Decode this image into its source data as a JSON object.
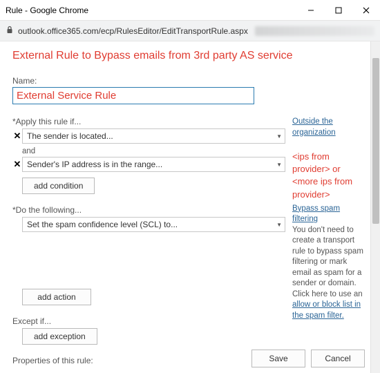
{
  "window": {
    "title": "Rule - Google Chrome"
  },
  "address": {
    "url_visible": "outlook.office365.com/ecp/RulesEditor/EditTransportRule.aspx"
  },
  "page": {
    "title": "External Rule to Bypass emails from 3rd party AS service",
    "name_label": "Name:",
    "name_value": "External Service Rule"
  },
  "apply": {
    "section_label": "*Apply this rule if...",
    "and_label": "and",
    "conditions": [
      {
        "text": "The sender is located..."
      },
      {
        "text": "Sender's IP address is in the range..."
      }
    ],
    "add_condition": "add condition"
  },
  "do": {
    "section_label": "*Do the following...",
    "actions": [
      {
        "text": "Set the spam confidence level (SCL) to..."
      }
    ],
    "add_action": "add action"
  },
  "except": {
    "section_label": "Except if...",
    "add_exception": "add exception"
  },
  "properties": {
    "section_label": "Properties of this rule:"
  },
  "side": {
    "link_outside": "Outside the organization",
    "annotation": "<ips from provider> or <more ips from  provider>",
    "link_bypass": "Bypass spam filtering",
    "helper_text": "You don't need to create a transport rule to bypass spam filtering or mark email as spam for a sender or domain. Click here to use an ",
    "link_allow": "allow or block list in the spam filter."
  },
  "footer": {
    "save": "Save",
    "cancel": "Cancel"
  }
}
